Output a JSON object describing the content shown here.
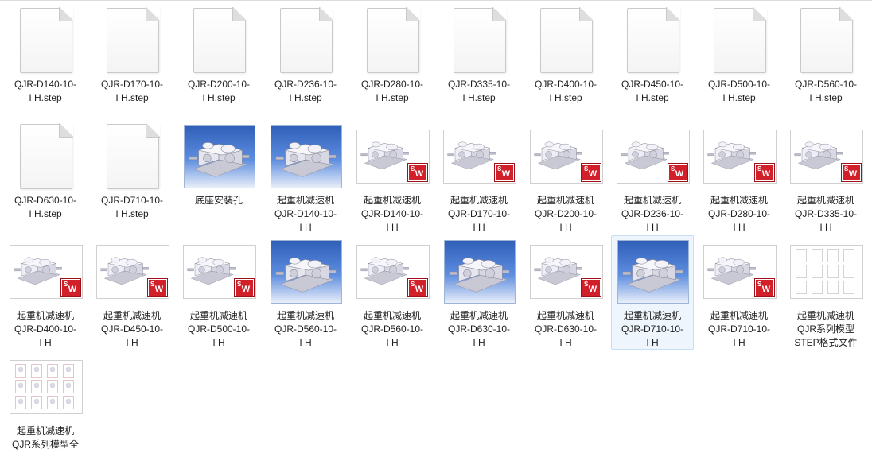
{
  "files": [
    {
      "name": "QJR-D140-10-\nI H.step",
      "kind": "doc"
    },
    {
      "name": "QJR-D170-10-\nI H.step",
      "kind": "doc"
    },
    {
      "name": "QJR-D200-10-\nI H.step",
      "kind": "doc"
    },
    {
      "name": "QJR-D236-10-\nI H.step",
      "kind": "doc"
    },
    {
      "name": "QJR-D280-10-\nI H.step",
      "kind": "doc"
    },
    {
      "name": "QJR-D335-10-\nI H.step",
      "kind": "doc"
    },
    {
      "name": "QJR-D400-10-\nI H.step",
      "kind": "doc"
    },
    {
      "name": "QJR-D450-10-\nI H.step",
      "kind": "doc"
    },
    {
      "name": "QJR-D500-10-\nI H.step",
      "kind": "doc"
    },
    {
      "name": "QJR-D560-10-\nI H.step",
      "kind": "doc"
    },
    {
      "name": "QJR-D630-10-\nI H.step",
      "kind": "doc"
    },
    {
      "name": "QJR-D710-10-\nI H.step",
      "kind": "doc"
    },
    {
      "name": "底座安装孔",
      "kind": "blue-large"
    },
    {
      "name": "起重机减速机\nQJR-D140-10-\nI H",
      "kind": "blue-large"
    },
    {
      "name": "起重机减速机\nQJR-D140-10-\nI H",
      "kind": "sw"
    },
    {
      "name": "起重机减速机\nQJR-D170-10-\nI H",
      "kind": "sw"
    },
    {
      "name": "起重机减速机\nQJR-D200-10-\nI H",
      "kind": "sw"
    },
    {
      "name": "起重机减速机\nQJR-D236-10-\nI H",
      "kind": "sw"
    },
    {
      "name": "起重机减速机\nQJR-D280-10-\nI H",
      "kind": "sw"
    },
    {
      "name": "起重机减速机\nQJR-D335-10-\nI H",
      "kind": "sw"
    },
    {
      "name": "起重机减速机\nQJR-D400-10-\nI H",
      "kind": "sw"
    },
    {
      "name": "起重机减速机\nQJR-D450-10-\nI H",
      "kind": "sw"
    },
    {
      "name": "起重机减速机\nQJR-D500-10-\nI H",
      "kind": "sw"
    },
    {
      "name": "起重机减速机\nQJR-D560-10-\nI H",
      "kind": "blue-large"
    },
    {
      "name": "起重机减速机\nQJR-D560-10-\nI H",
      "kind": "sw"
    },
    {
      "name": "起重机减速机\nQJR-D630-10-\nI H",
      "kind": "blue-large"
    },
    {
      "name": "起重机减速机\nQJR-D630-10-\nI H",
      "kind": "sw"
    },
    {
      "name": "起重机减速机\nQJR-D710-10-\nI H",
      "kind": "blue-large",
      "selected": true
    },
    {
      "name": "起重机减速机\nQJR-D710-10-\nI H",
      "kind": "sw"
    },
    {
      "name": "起重机减速机\nQJR系列模型\nSTEP格式文件",
      "kind": "multi"
    },
    {
      "name": "起重机减速机\nQJR系列模型全",
      "kind": "multi-red"
    }
  ],
  "colors": {
    "selection": "#eef5fd",
    "sw_badge": "#d1202a",
    "text": "#1e1e1e"
  }
}
